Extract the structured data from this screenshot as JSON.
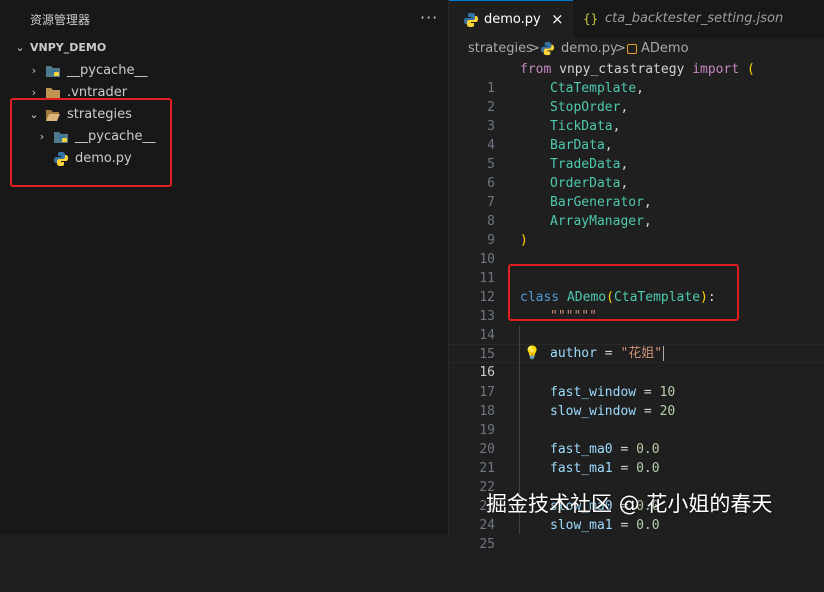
{
  "sidebar": {
    "title": "资源管理器",
    "more": "···",
    "root": "VNPY_DEMO",
    "items": [
      {
        "label": "__pycache__",
        "icon": "python-folder-icon"
      },
      {
        "label": ".vntrader",
        "icon": "folder-icon"
      },
      {
        "label": "strategies",
        "icon": "folder-open-icon"
      },
      {
        "label": "__pycache__",
        "icon": "python-folder-icon"
      },
      {
        "label": "demo.py",
        "icon": "python-file-icon"
      }
    ]
  },
  "tabs": [
    {
      "label": "demo.py",
      "active": true,
      "close": "×"
    },
    {
      "label": "cta_backtester_setting.json",
      "active": false,
      "icon_text": "{}"
    }
  ],
  "breadcrumb": {
    "folder": "strategies",
    "file": "demo.py",
    "symbol": "ADemo",
    "sep": ">"
  },
  "line_numbers": [
    "1",
    "2",
    "3",
    "4",
    "5",
    "6",
    "7",
    "8",
    "9",
    "10",
    "11",
    "12",
    "13",
    "14",
    "15",
    "16",
    "17",
    "18",
    "19",
    "20",
    "21",
    "22",
    "23",
    "24",
    "25"
  ],
  "code": {
    "l1_from": "from",
    "l1_mod": "vnpy_ctastrategy",
    "l1_import": "import",
    "l1_paren": "(",
    "imports": [
      "CtaTemplate",
      "StopOrder",
      "TickData",
      "BarData",
      "TradeData",
      "OrderData",
      "BarGenerator",
      "ArrayManager"
    ],
    "comma": ",",
    "l10": ")",
    "l13_class": "class",
    "l13_name": "ADemo",
    "l13_open": "(",
    "l13_base": "CtaTemplate",
    "l13_close": ")",
    "l13_colon": ":",
    "l14": "\"\"\"\"\"\"",
    "l16_var": "author",
    "l16_str": "\"花姐\"",
    "eq": " = ",
    "l18_var": "fast_window",
    "l18_val": "10",
    "l19_var": "slow_window",
    "l19_val": "20",
    "l21_var": "fast_ma0",
    "l21_val": "0.0",
    "l22_var": "fast_ma1",
    "l22_val": "0.0",
    "l24_var": "slow_ma0",
    "l24_val": "0.0",
    "l25_var": "slow_ma1",
    "l25_val": "0.0"
  },
  "watermark": "掘金技术社区 @ 花小姐的春天",
  "colors": {
    "annotation": "#e02020",
    "accent": "#0078d4"
  }
}
